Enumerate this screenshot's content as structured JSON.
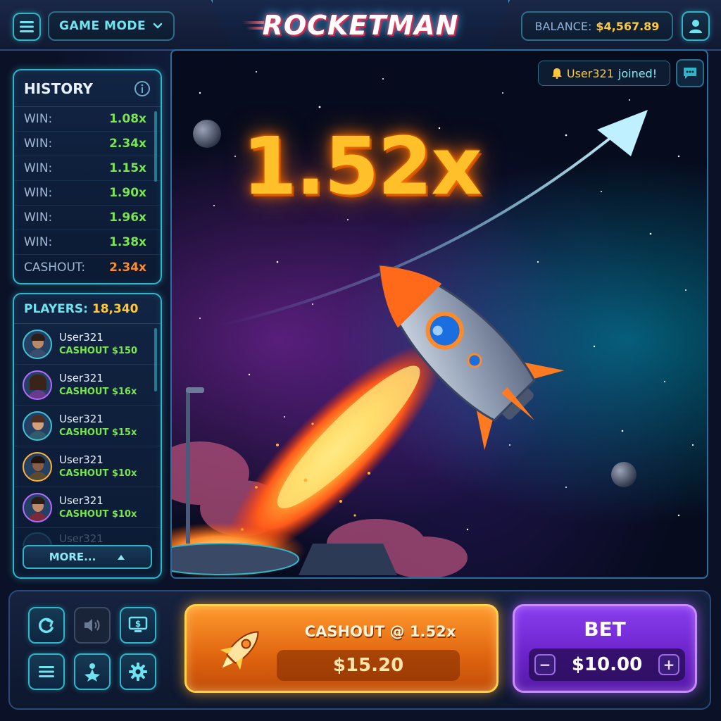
{
  "header": {
    "game_mode_label": "GAME MODE",
    "logo_text": "ROCKETMAN",
    "balance_label": "BALANCE:",
    "balance_value": "$4,567.89"
  },
  "history": {
    "title": "HISTORY",
    "rows": [
      {
        "label": "WIN:",
        "value": "1.08x"
      },
      {
        "label": "WIN:",
        "value": "2.34x"
      },
      {
        "label": "WIN:",
        "value": "1.15x"
      },
      {
        "label": "WIN:",
        "value": "1.90x"
      },
      {
        "label": "WIN:",
        "value": "1.96x"
      },
      {
        "label": "WIN:",
        "value": "1.38x"
      },
      {
        "label": "CASHOUT:",
        "value": "2.34x"
      }
    ]
  },
  "players": {
    "label": "PLAYERS:",
    "count": "18,340",
    "rows": [
      {
        "name": "User321",
        "cashout": "CASHOUT $150"
      },
      {
        "name": "User321",
        "cashout": "CASHOUT $16x"
      },
      {
        "name": "User321",
        "cashout": "CASHOUT $15x"
      },
      {
        "name": "User321",
        "cashout": "CASHOUT $10x"
      },
      {
        "name": "User321",
        "cashout": "CASHOUT $10x"
      },
      {
        "name": "User321",
        "cashout": ""
      }
    ],
    "more_label": "MORE..."
  },
  "game": {
    "multiplier": "1.52x",
    "toast_user": "User321",
    "toast_message": "joined!"
  },
  "controls": {
    "cashout_label": "CASHOUT @ 1.52x",
    "cashout_amount": "$15.20",
    "bet_label": "BET",
    "bet_value": "$10.00",
    "bet_minus": "−",
    "bet_plus": "+"
  },
  "colors": {
    "accent_cyan": "#2fb7c9",
    "win_green": "#78e64c",
    "cashout_orange": "#ff8a2a",
    "balance_gold": "#ffc83a",
    "bet_purple": "#8a3ef0"
  }
}
